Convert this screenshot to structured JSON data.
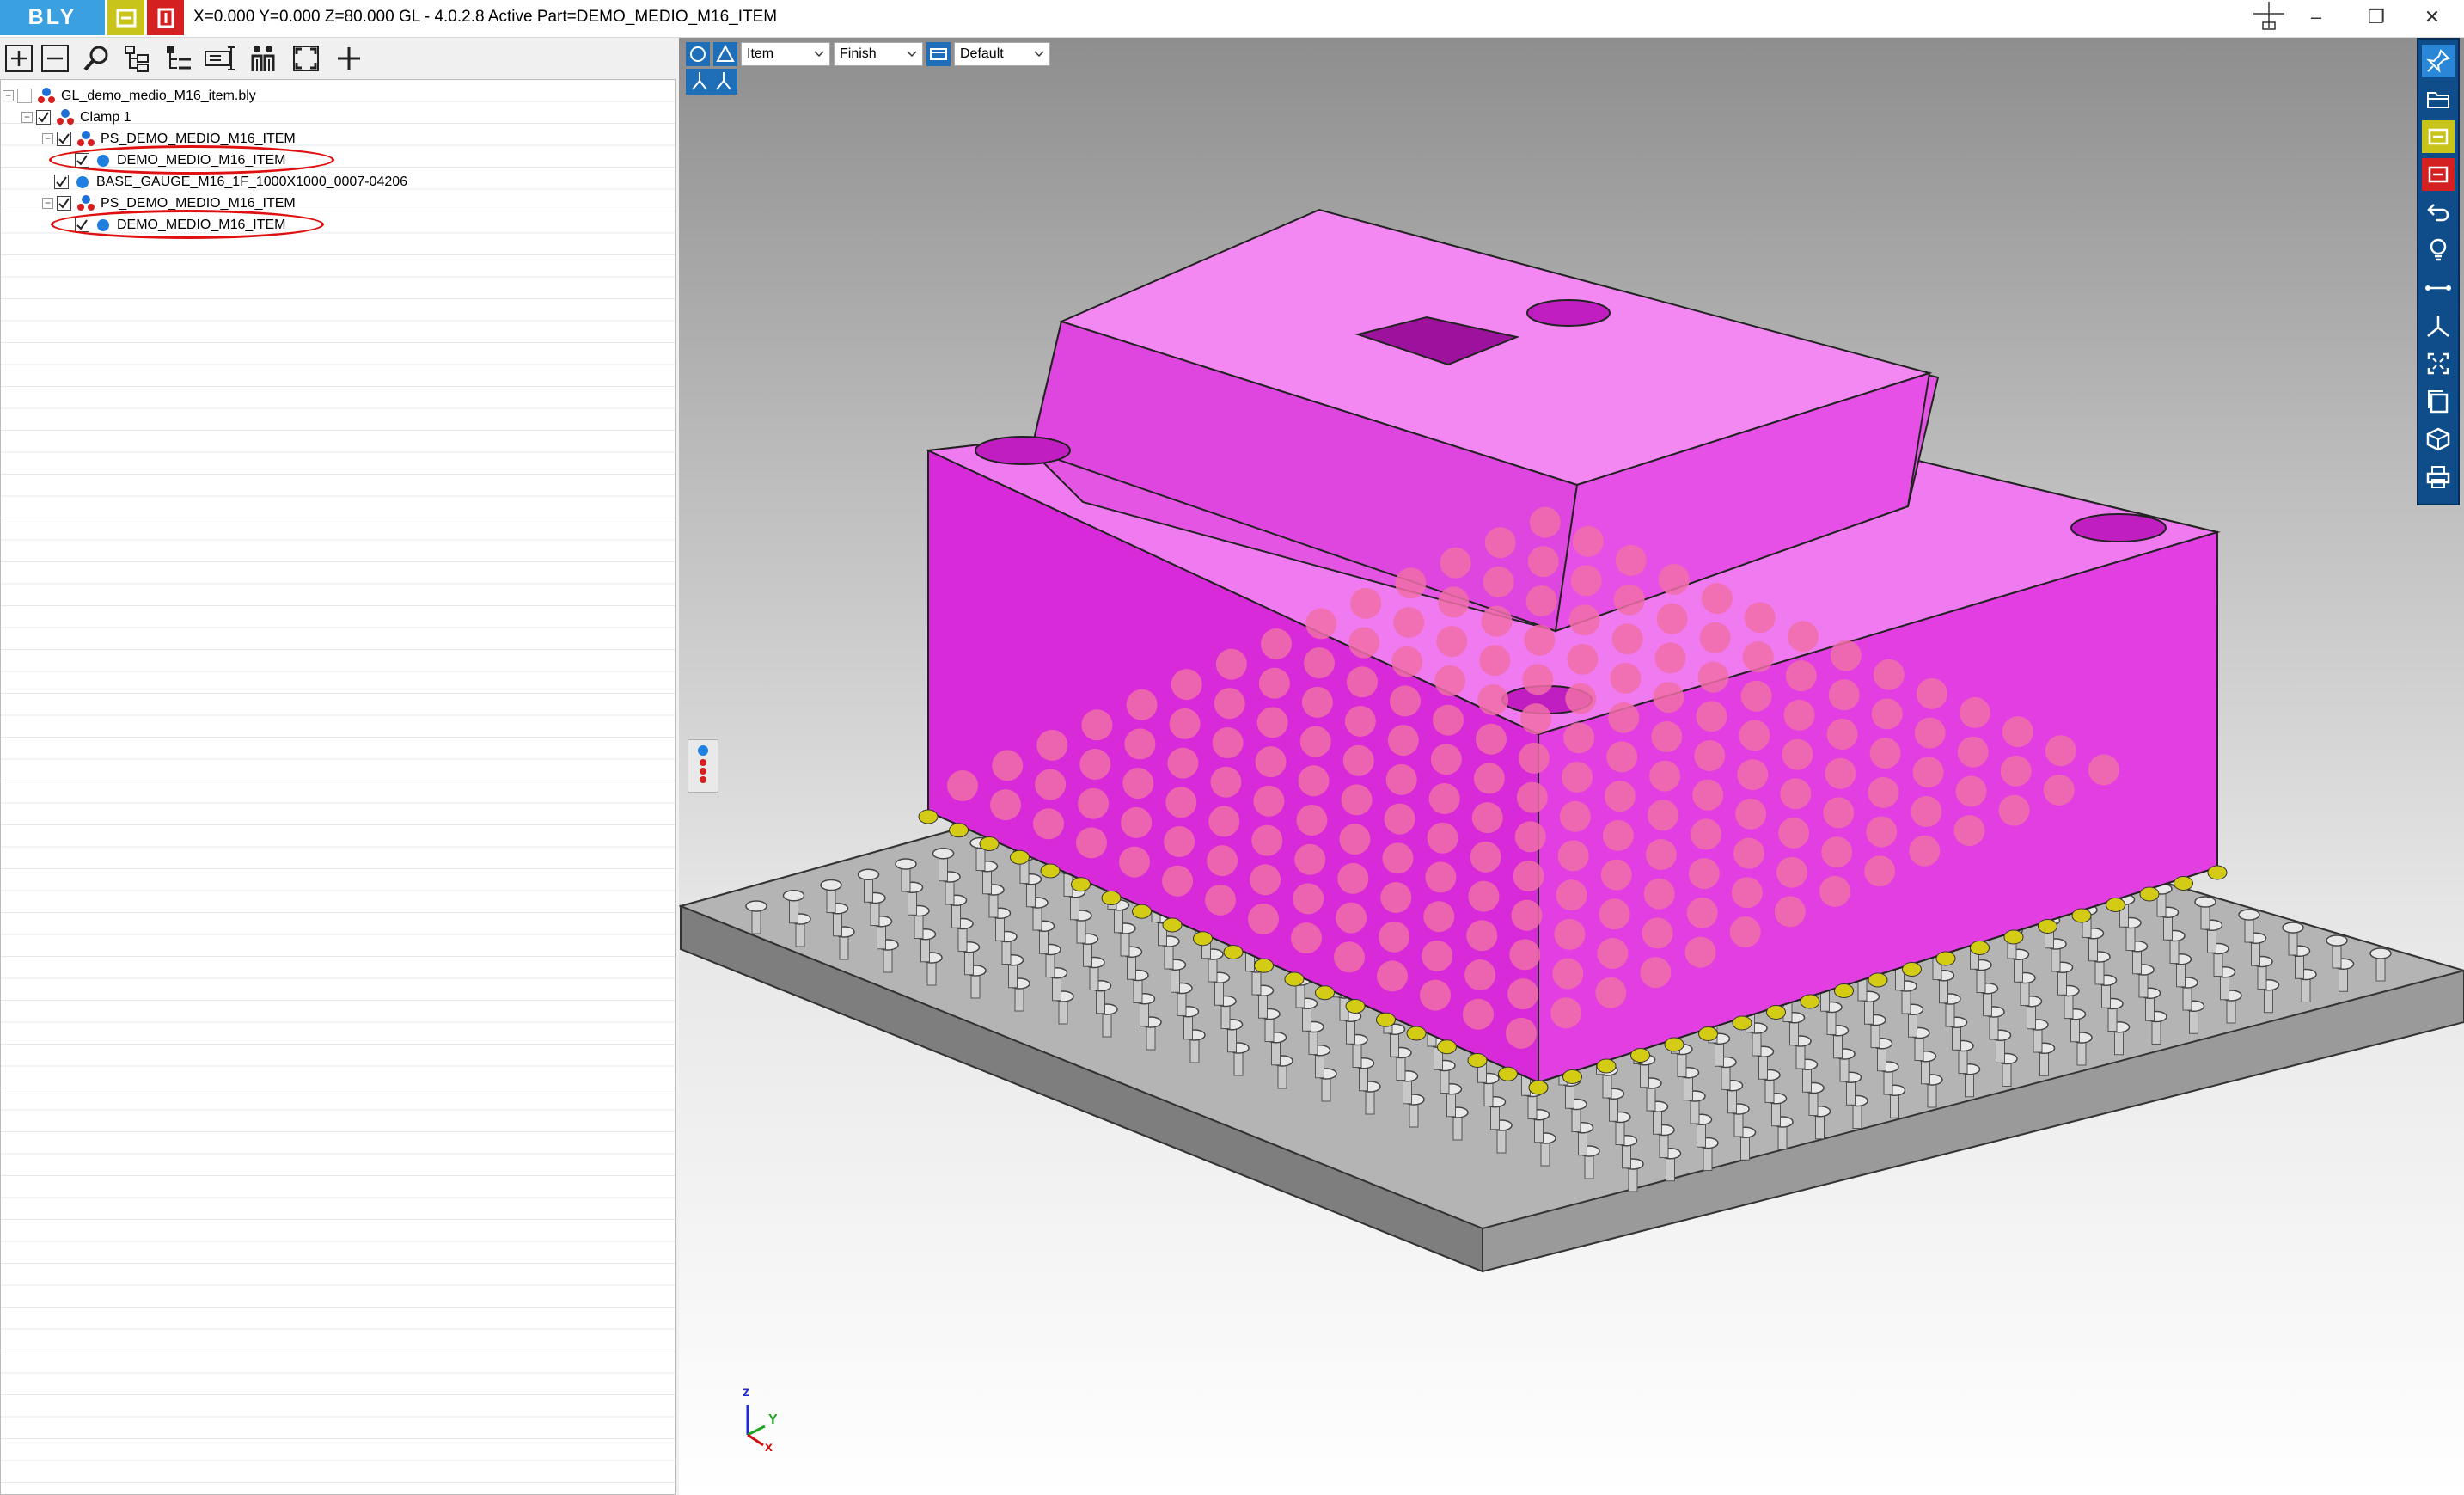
{
  "app": {
    "logo": "BLY",
    "status": "X=0.000 Y=0.000 Z=80.000   GL - 4.0.2.8 Active Part=DEMO_MEDIO_M16_ITEM"
  },
  "window_controls": {
    "minimize": "–",
    "restore": "❐",
    "close": "✕"
  },
  "tree": {
    "items": [
      {
        "label": "GL_demo_medio_M16_item.bly",
        "checked": false
      },
      {
        "label": "Clamp 1",
        "checked": true
      },
      {
        "label": "PS_DEMO_MEDIO_M16_ITEM",
        "checked": true
      },
      {
        "label": "DEMO_MEDIO_M16_ITEM",
        "checked": true,
        "highlighted": true
      },
      {
        "label": "BASE_GAUGE_M16_1F_1000X1000_0007-04206",
        "checked": true
      },
      {
        "label": "PS_DEMO_MEDIO_M16_ITEM",
        "checked": true
      },
      {
        "label": "DEMO_MEDIO_M16_ITEM",
        "checked": true,
        "highlighted": true
      }
    ]
  },
  "viewport": {
    "selects": {
      "mode": "Item",
      "quality": "Finish",
      "view": "Default"
    },
    "axes": {
      "z": "z",
      "y": "Y",
      "x": "x"
    }
  },
  "colors": {
    "part": "#ee10ee",
    "accent": "#1f6fb8",
    "highlight": "#e01010",
    "pin_yellow": "#d4cc14"
  }
}
